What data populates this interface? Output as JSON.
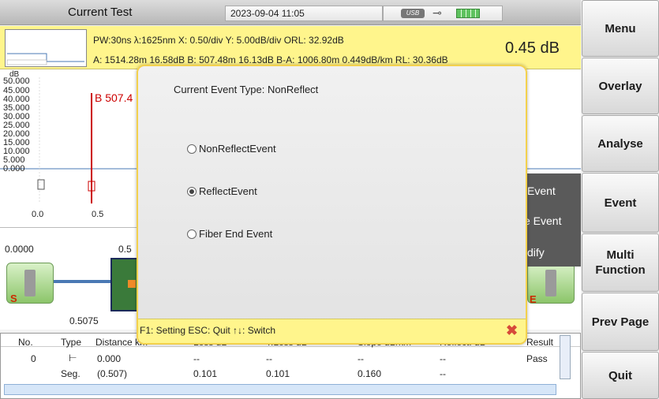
{
  "header": {
    "title": "Current Test",
    "datetime": "2023-09-04 11:05",
    "status_usb": "USB"
  },
  "info": {
    "line1": "PW:30ns λ:1625nm  X: 0.50/div Y: 5.00dB/div ORL: 32.92dB",
    "line2": "A: 1514.28m 16.58dB B: 507.48m 16.13dB B-A: 1006.80m 0.449dB/km RL: 30.36dB",
    "loss_value": "0.45 dB"
  },
  "graph": {
    "y_unit": "dB",
    "y_ticks": [
      "50.000",
      "45.000",
      "40.000",
      "35.000",
      "30.000",
      "25.000",
      "20.000",
      "15.000",
      "10.000",
      "5.000",
      "0.000"
    ],
    "x_ticks": [
      "0.0",
      "0.5"
    ],
    "marker_b_label": "B 507.4"
  },
  "right_menu": {
    "menu": "Menu",
    "overlay": "Overlay",
    "analyse": "Analyse",
    "event": "Event",
    "multi_function": "Multi Function",
    "prev_page": "Prev Page",
    "quit": "Quit"
  },
  "submenu": {
    "item1": "Event",
    "item2": "e Event",
    "item3": "dify"
  },
  "map": {
    "left_value": "0.0000",
    "mid_value": "0.5",
    "bottom_value": "0.5075",
    "start_label": "S",
    "end_label": "E"
  },
  "table": {
    "headers": [
      "No.",
      "Type",
      "Distance km",
      "Loss dB",
      "T.Loss dB",
      "Slope dB/km",
      "Reflect. dB",
      "Result"
    ],
    "rows": [
      [
        "0",
        "⊢",
        "0.000",
        "--",
        "--",
        "--",
        "--",
        "Pass"
      ],
      [
        "",
        "Seg.",
        "(0.507)",
        "0.101",
        "0.101",
        "0.160",
        "--",
        ""
      ]
    ]
  },
  "dialog": {
    "heading": "Current Event Type: NonReflect",
    "options": [
      "NonReflectEvent",
      "ReflectEvent",
      "Fiber End Event"
    ],
    "selected": 1,
    "footer": "F1: Setting  ESC: Quit  ↑↓: Switch"
  },
  "colors": {
    "info_bg": "#fff58c",
    "marker": "#cc0000",
    "trace": "#4a79b4"
  }
}
